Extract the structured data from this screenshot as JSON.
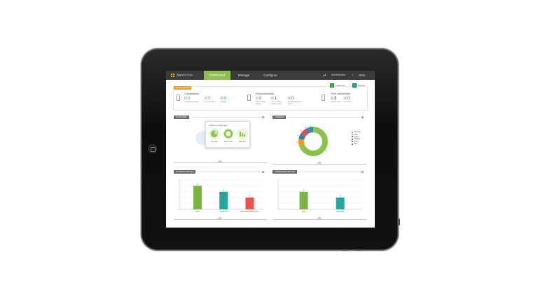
{
  "app": {
    "brand": "XenMobile",
    "brand_part1": "Xen",
    "brand_part2": "Mobile"
  },
  "nav": {
    "tabs": [
      {
        "label": "Dashboard",
        "active": true
      },
      {
        "label": "Manage",
        "active": false
      },
      {
        "label": "Configure",
        "active": false
      }
    ],
    "user_label": "administrator",
    "vendor": "citrix"
  },
  "notifications": {
    "badge": "NOTIFICATIONS",
    "buttons": [
      {
        "label": "Customize",
        "icon": "customize-icon"
      },
      {
        "label": "Refresh",
        "icon": "refresh-icon"
      }
    ],
    "groups": [
      {
        "title": "Compliance",
        "items": [
          {
            "value": "0",
            "color": "#4caf50",
            "label": "Compliant devices"
          },
          {
            "value": "5",
            "color": "#e67e22",
            "label": "Non-compliant"
          },
          {
            "value": "0",
            "color": "#4caf50",
            "label": "Inactive"
          }
        ]
      },
      {
        "title": "Decommission",
        "items": [
          {
            "value": "0",
            "color": "#888888",
            "label": "Lost or stolen devices"
          },
          {
            "value": "1",
            "color": "#555555",
            "label": "Lost or stolen selective wipe"
          },
          {
            "value": "0",
            "color": "#888888",
            "label": "Pending selective wipes"
          }
        ]
      },
      {
        "title": "First connection",
        "items": [
          {
            "value": "3",
            "color": "#555555",
            "label": "Last 24 hours"
          },
          {
            "value": "0",
            "color": "#888888",
            "label": "Last week"
          }
        ]
      }
    ]
  },
  "panels": {
    "platforms": {
      "title": "PLATFORMS",
      "chooser_title": "Choose a chart type",
      "chooser_options": [
        "Pie chart",
        "Donut chart",
        "Bar chart"
      ]
    },
    "carriers": {
      "title": "CARRIERS",
      "donut_values": [
        {
          "label": "Unknown",
          "value": 70,
          "color": "#8bc34a"
        },
        {
          "label": "AT&T",
          "value": 8,
          "color": "#f39c12"
        },
        {
          "label": "Verizon",
          "value": 6,
          "color": "#2980b9"
        },
        {
          "label": "T-Mobile",
          "value": 5,
          "color": "#e74c3c"
        },
        {
          "label": "Sprint",
          "value": 6,
          "color": "#9b59b6"
        },
        {
          "label": "Other",
          "value": 5,
          "color": "#16a085"
        }
      ]
    },
    "managed": {
      "title": "MANAGED DEVICES",
      "categories": [
        "iOS",
        "Android",
        "Windows Phone 8.x"
      ],
      "values": [
        4,
        3,
        2
      ],
      "colors": [
        "#7cb342",
        "#26a69a",
        "#ef5350"
      ],
      "ylim": [
        0,
        5
      ]
    },
    "unmanaged": {
      "title": "UNMANAGED DEVICES",
      "categories": [
        "iOS",
        "Android"
      ],
      "values": [
        3,
        2
      ],
      "colors": [
        "#7cb342",
        "#26a69a"
      ],
      "ylim": [
        0,
        5
      ]
    }
  },
  "chart_data": [
    {
      "type": "bar",
      "title": "MANAGED DEVICES",
      "categories": [
        "iOS",
        "Android",
        "Windows Phone 8.x"
      ],
      "values": [
        4,
        3,
        2
      ],
      "ylim": [
        0,
        5
      ]
    },
    {
      "type": "bar",
      "title": "UNMANAGED DEVICES",
      "categories": [
        "iOS",
        "Android"
      ],
      "values": [
        3,
        2
      ],
      "ylim": [
        0,
        5
      ]
    },
    {
      "type": "pie",
      "title": "CARRIERS",
      "categories": [
        "Unknown",
        "AT&T",
        "Verizon",
        "T-Mobile",
        "Sprint",
        "Other"
      ],
      "values": [
        70,
        8,
        6,
        5,
        6,
        5
      ]
    }
  ]
}
